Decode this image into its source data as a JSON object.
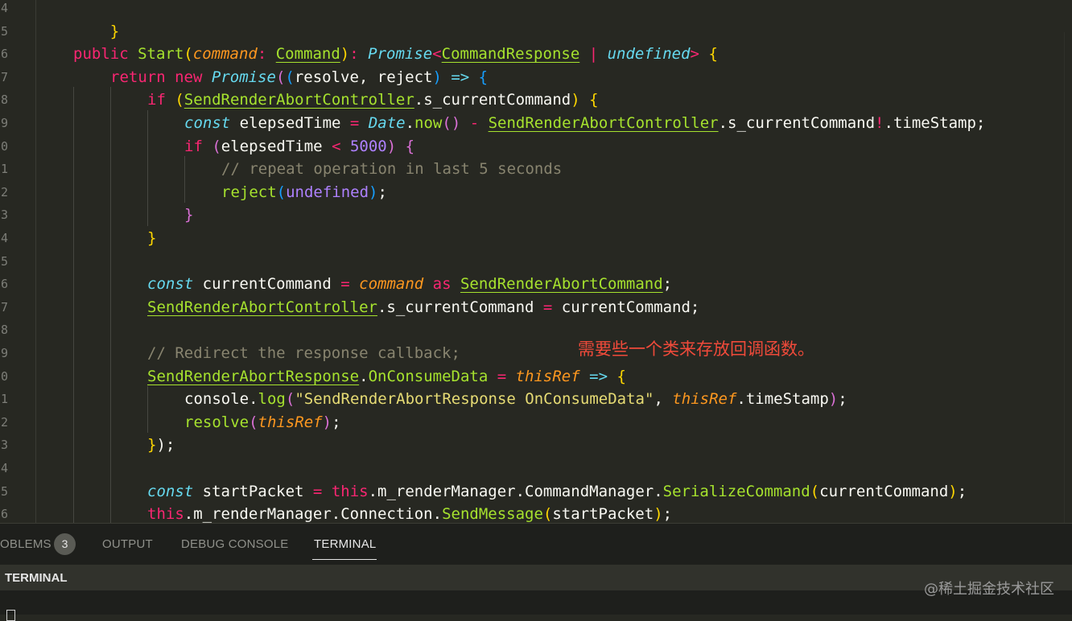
{
  "gutter": {
    "line_numbers": [
      "4",
      "5",
      "6",
      "7",
      "8",
      "9",
      "0",
      "1",
      "2",
      "3",
      "4",
      "5",
      "6",
      "7",
      "8",
      "9",
      "0",
      "1",
      "2",
      "3",
      "4",
      "5",
      "6"
    ]
  },
  "code": {
    "l01": {
      "brace": "}"
    },
    "l03": {
      "public": "public",
      "name": "Start",
      "p_open": "(",
      "param": "command",
      "colon": ": ",
      "param_type": "Command",
      "p_close": ")",
      "colon2": ": ",
      "promise": "Promise",
      "lt": "<",
      "resp": "CommandResponse",
      "pipe": " | ",
      "undef": "undefined",
      "gt": ">",
      "sp": " ",
      "brace": "{"
    },
    "l04": {
      "ret": "return",
      "sp1": " ",
      "new": "new",
      "sp2": " ",
      "promise": "Promise",
      "p1": "(",
      "p2": "(",
      "args": "resolve, reject",
      "p3": ")",
      "arrow": " => ",
      "brace": "{"
    },
    "l05": {
      "if": "if",
      "sp": " ",
      "p1": "(",
      "cls": "SendRenderAbortController",
      "rest": ".s_currentCommand",
      "p2": ")",
      "sp2": " ",
      "brace": "{"
    },
    "l06": {
      "const": "const",
      "var": " elepsedTime ",
      "eq": "=",
      "sp": " ",
      "date": "Date",
      "dot": ".",
      "now": "now",
      "pp": "()",
      "minus": " - ",
      "cls": "SendRenderAbortController",
      "rest": ".s_currentCommand",
      "bang": "!",
      "rest2": ".timeStamp;"
    },
    "l07": {
      "if": "if",
      "sp": " ",
      "p1": "(",
      "var": "elepsedTime ",
      "lt": "<",
      "sp2": " ",
      "num": "5000",
      "p2": ")",
      "sp3": " ",
      "brace": "{"
    },
    "l08": {
      "comment": "// repeat operation in last 5 seconds"
    },
    "l09": {
      "fn": "reject",
      "p1": "(",
      "undef": "undefined",
      "p2": ")",
      "semi": ";"
    },
    "l10": {
      "brace": "}"
    },
    "l11": {
      "brace": "}"
    },
    "l13": {
      "const": "const",
      "var": " currentCommand ",
      "eq": "=",
      "sp": " ",
      "param": "command",
      "as": " as ",
      "cls": "SendRenderAbortCommand",
      "semi": ";"
    },
    "l14": {
      "cls": "SendRenderAbortController",
      "rest": ".s_currentCommand ",
      "eq": "=",
      "rest2": " currentCommand;"
    },
    "l16": {
      "comment": "// Redirect the response callback;"
    },
    "l17": {
      "cls": "SendRenderAbortResponse",
      "dot": ".",
      "member": "OnConsumeData",
      "eq": " = ",
      "param": "thisRef",
      "arrow": " => ",
      "brace": "{"
    },
    "l18": {
      "obj": "console",
      "dot": ".",
      "fn": "log",
      "p1": "(",
      "str": "\"SendRenderAbortResponse OnConsumeData\"",
      "comma": ", ",
      "param": "thisRef",
      "rest": ".timeStamp",
      "p2": ")",
      "semi": ";"
    },
    "l19": {
      "fn": "resolve",
      "p1": "(",
      "param": "thisRef",
      "p2": ")",
      "semi": ";"
    },
    "l20": {
      "brace": "}",
      "p": ")",
      "semi": ";"
    },
    "l22": {
      "const": "const",
      "var": " startPacket ",
      "eq": "=",
      "sp": " ",
      "this": "this",
      "rest": ".m_renderManager.CommandManager.",
      "fn": "SerializeCommand",
      "p1": "(",
      "arg": "currentCommand",
      "p2": ")",
      "semi": ";"
    },
    "l23": {
      "this": "this",
      "rest": ".m_renderManager.Connection.",
      "fn": "SendMessage",
      "p1": "(",
      "arg": "startPacket",
      "p2": ")",
      "semi": ";"
    }
  },
  "annotation": "需要些一个类来存放回调函数。",
  "panel": {
    "tabs": {
      "problems": "OBLEMS",
      "problems_count": "3",
      "output": "OUTPUT",
      "debug_console": "DEBUG CONSOLE",
      "terminal": "TERMINAL"
    },
    "terminal_title": "TERMINAL"
  },
  "watermark": "@稀土掘金技术社区",
  "colors": {
    "background": "#272822",
    "keyword": "#f92672",
    "type": "#66d9ef",
    "function": "#a6e22e",
    "parameter": "#fd971f",
    "number": "#ae81ff",
    "comment": "#88846f",
    "annotation": "#f04a3a"
  }
}
